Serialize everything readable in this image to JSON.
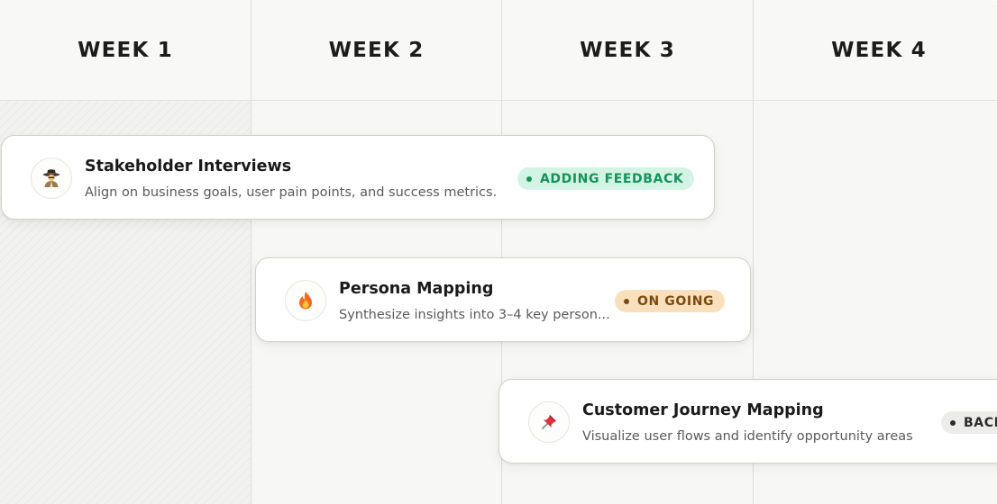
{
  "weeks": [
    {
      "label": "WEEK 1"
    },
    {
      "label": "WEEK 2"
    },
    {
      "label": "WEEK 3"
    },
    {
      "label": "WEEK 4"
    }
  ],
  "tasks": [
    {
      "title": "Stakeholder Interviews",
      "description": "Align on business goals, user pain points, and success metrics.",
      "icon": "detective-icon",
      "status": {
        "label": "ADDING FEEDBACK",
        "bg": "#d3f4e4",
        "fg": "#16925a",
        "dot": "#16925a"
      }
    },
    {
      "title": "Persona Mapping",
      "description": "Synthesize insights into 3–4 key person...",
      "icon": "fire-icon",
      "status": {
        "label": "ON GOING",
        "bg": "#f9e0bc",
        "fg": "#7a4a12",
        "dot": "#7a4a12"
      }
    },
    {
      "title": "Customer Journey Mapping",
      "description": "Visualize user flows and identify opportunity areas",
      "icon": "pushpin-icon",
      "status": {
        "label": "BACKLOG",
        "bg": "#ececea",
        "fg": "#2a2a2a",
        "dot": "#2a2a2a"
      }
    }
  ]
}
